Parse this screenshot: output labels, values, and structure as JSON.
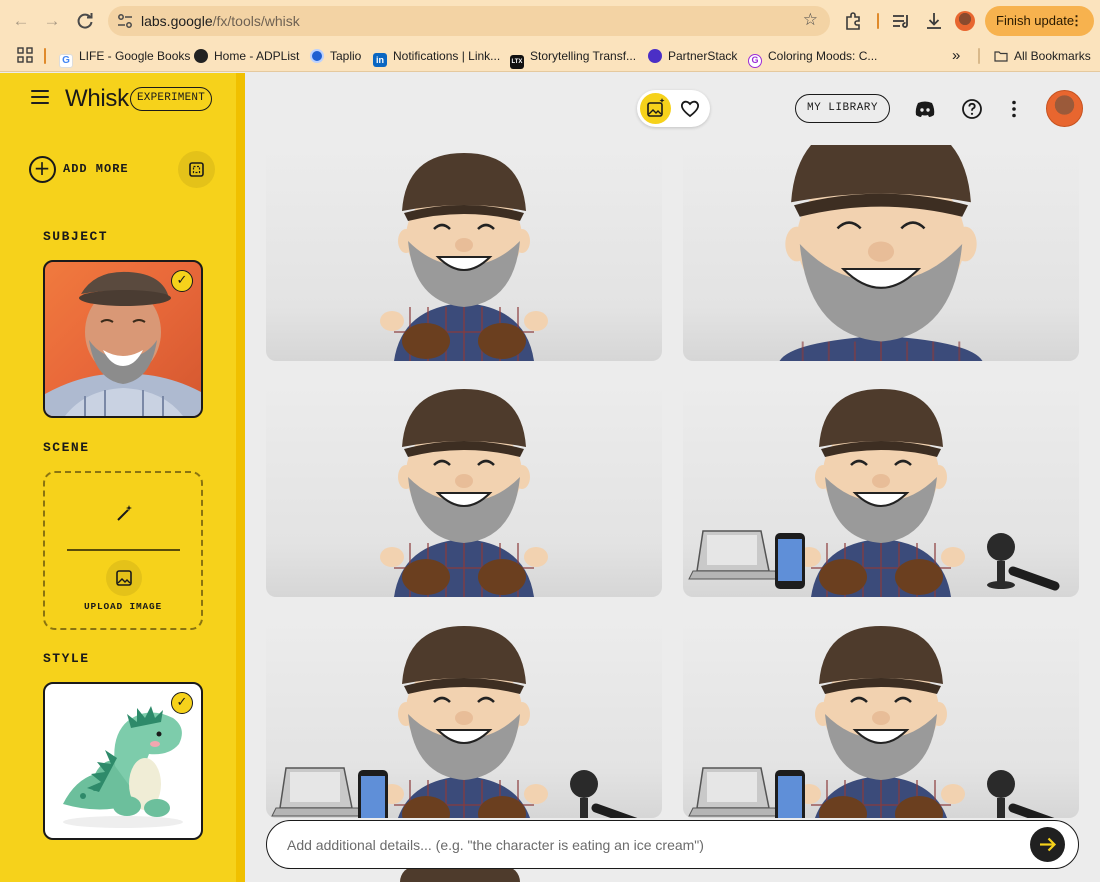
{
  "browser": {
    "url_host": "labs.google",
    "url_path": "/fx/tools/whisk",
    "finish_update_label": "Finish update",
    "bookmarks": [
      {
        "label": "LIFE - Google Books",
        "icon": "google-icon"
      },
      {
        "label": "Home - ADPList",
        "icon": "adplist-icon"
      },
      {
        "label": "Taplio",
        "icon": "taplio-icon"
      },
      {
        "label": "Notifications | Link...",
        "icon": "linkedin-icon"
      },
      {
        "label": "Storytelling Transf...",
        "icon": "ltx-icon"
      },
      {
        "label": "PartnerStack",
        "icon": "partnerstack-icon"
      },
      {
        "label": "Coloring Moods: C...",
        "icon": "coloring-icon"
      }
    ],
    "overflow_label": "»",
    "all_bookmarks_label": "All Bookmarks"
  },
  "app": {
    "title": "Whisk",
    "badge": "EXPERIMENT",
    "accent_color": "#f6d21b"
  },
  "sidebar": {
    "add_more_label": "ADD MORE",
    "subject_label": "SUBJECT",
    "scene_label": "SCENE",
    "upload_label": "UPLOAD IMAGE",
    "style_label": "STYLE"
  },
  "header": {
    "my_library_label": "MY LIBRARY"
  },
  "prompt": {
    "placeholder": "Add additional details... (e.g. \"the character is eating an ice cream\")"
  },
  "gallery": [
    {
      "variant": "plain"
    },
    {
      "variant": "closeup"
    },
    {
      "variant": "plain"
    },
    {
      "variant": "props"
    },
    {
      "variant": "props"
    },
    {
      "variant": "props"
    }
  ]
}
